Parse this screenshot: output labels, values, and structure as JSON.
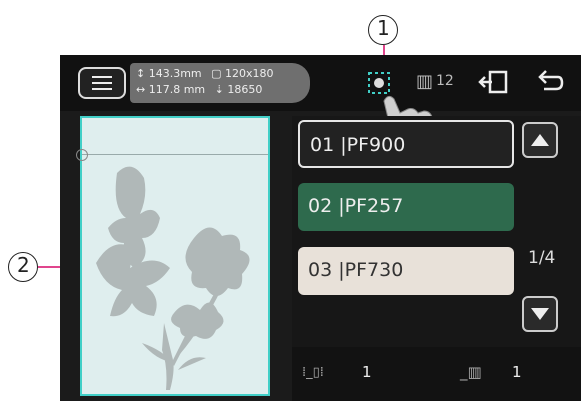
{
  "topbar": {
    "height": "143.3mm",
    "width": "117.8 mm",
    "hoop": "120x180",
    "stitches": "18650",
    "color_count": "12"
  },
  "threads": [
    {
      "num": "01",
      "code": "PF900"
    },
    {
      "num": "02",
      "code": "PF257"
    },
    {
      "num": "03",
      "code": "PF730"
    }
  ],
  "pager": "1/4",
  "bottom": {
    "left_value": "1",
    "right_value": "1"
  },
  "callouts": {
    "one": "1",
    "two": "2"
  },
  "colors": {
    "accent": "#e0458d",
    "selected_green": "#2e6a4d",
    "frame": "#41cfc7"
  },
  "icons": [
    "menu-icon",
    "height-icon",
    "width-icon",
    "hoop-icon",
    "stitch-count-icon",
    "trace-icon",
    "spool-icon",
    "exit-icon",
    "undo-icon",
    "up-arrow-icon",
    "down-arrow-icon",
    "thread-sort-icon"
  ]
}
